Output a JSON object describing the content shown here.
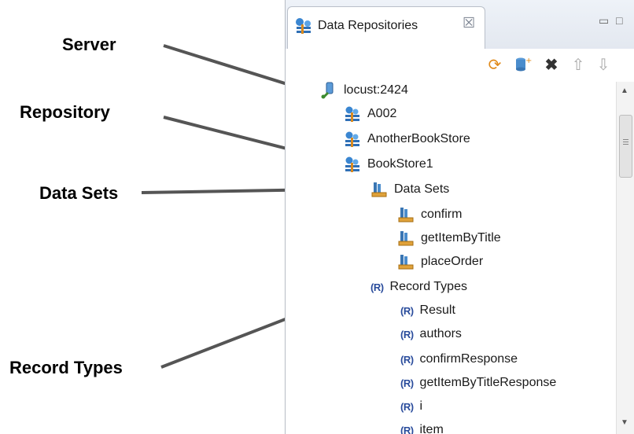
{
  "callouts": {
    "server": "Server",
    "repository": "Repository",
    "data_sets": "Data Sets",
    "record_types": "Record Types"
  },
  "panel": {
    "tab_title": "Data Repositories",
    "tab_icon": "data-repositories-icon",
    "close_glyph": "☒",
    "toolbar": [
      "refresh-icon",
      "add-datasource-icon",
      "delete-icon",
      "import-icon",
      "export-icon"
    ]
  },
  "tree": {
    "server": "locust:2424",
    "repositories": [
      "A002",
      "AnotherBookStore",
      "BookStore1"
    ],
    "data_sets_label": "Data Sets",
    "data_sets": [
      "confirm",
      "getItemByTitle",
      "placeOrder"
    ],
    "record_types_label": "Record Types",
    "record_type_badge": "(R)",
    "record_types": [
      "Result",
      "authors",
      "confirmResponse",
      "getItemByTitleResponse",
      "i",
      "item"
    ]
  },
  "colors": {
    "callout_line": "#555555",
    "record_badge": "#2a4c9c",
    "repository_icon": "#2f7fc9"
  }
}
